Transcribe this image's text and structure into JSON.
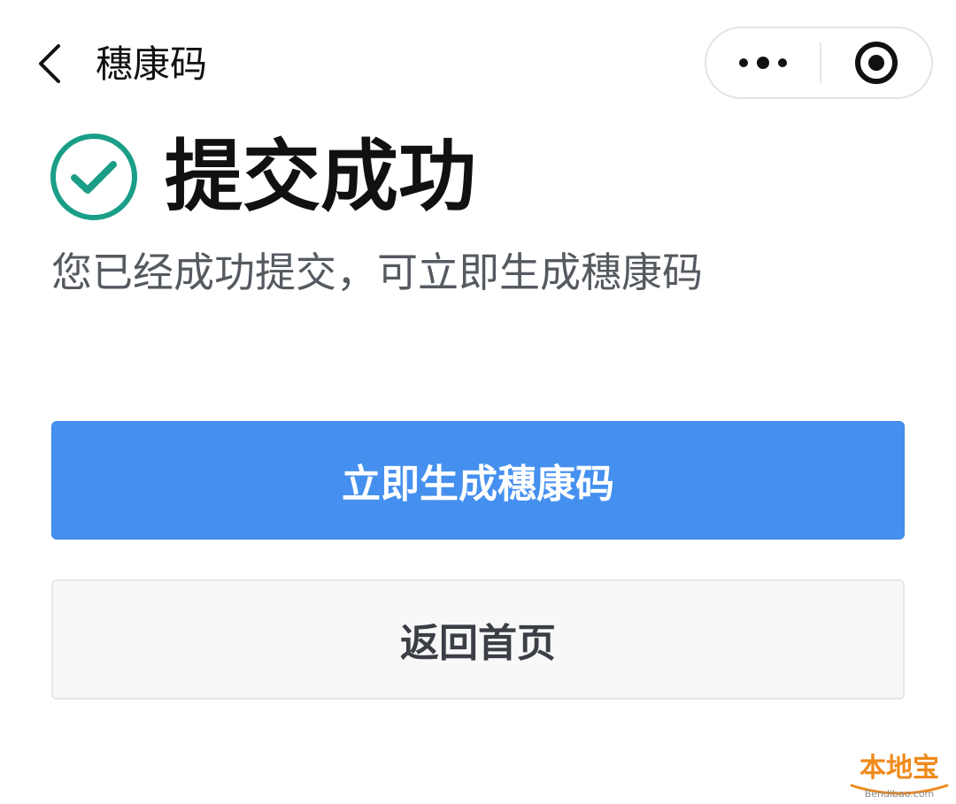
{
  "nav": {
    "title": "穗康码",
    "back_icon": "chevron-left-icon",
    "more_icon": "more-dots-icon",
    "close_icon": "target-circle-icon"
  },
  "result": {
    "icon": "check-circle-icon",
    "title": "提交成功",
    "description": "您已经成功提交，可立即生成穗康码"
  },
  "buttons": {
    "primary_label": "立即生成穗康码",
    "secondary_label": "返回首页"
  },
  "watermark": {
    "brand": "本地宝",
    "domain": "Bendibao.com"
  },
  "colors": {
    "accent_blue": "#4590ef",
    "success_teal": "#1a9e88",
    "secondary_text": "#555a60",
    "watermark_orange": "#f08a1c"
  }
}
